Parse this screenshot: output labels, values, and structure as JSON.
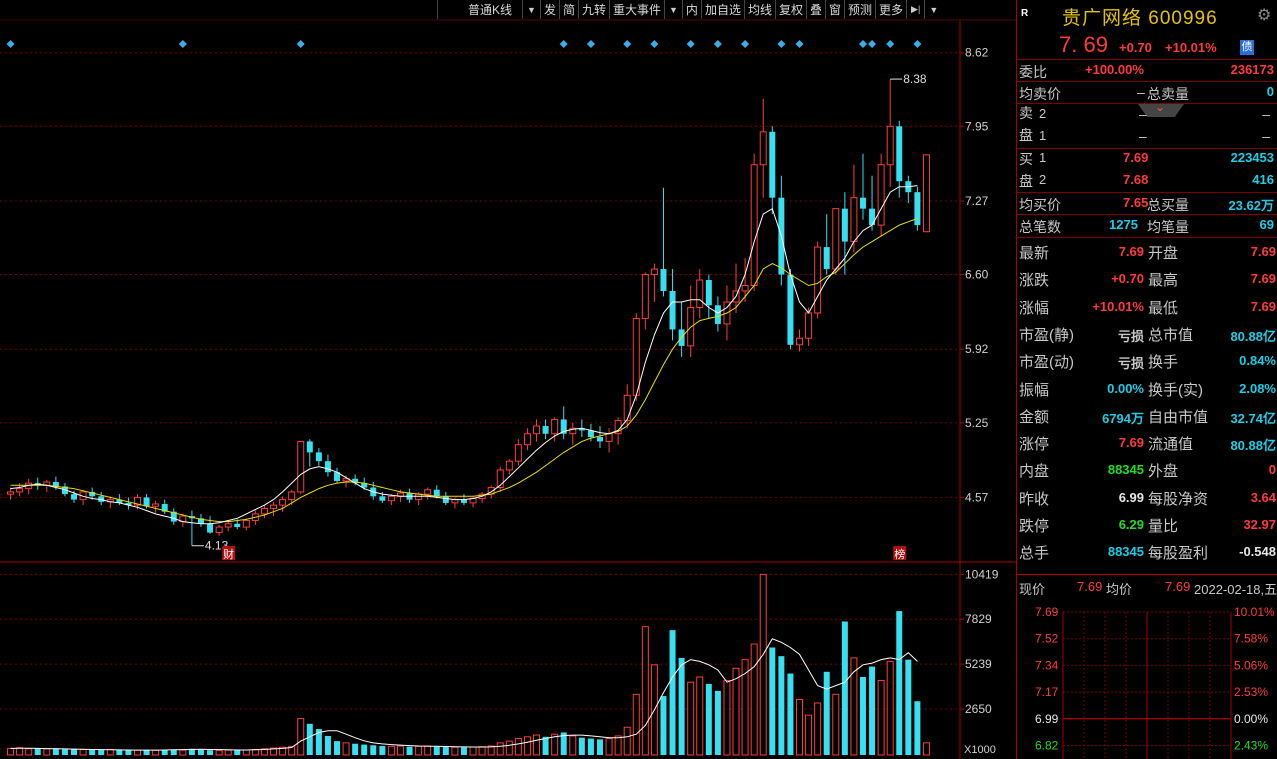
{
  "toolbar": {
    "items": [
      "普通K线",
      "发",
      "简",
      "九转",
      "重大事件",
      "内",
      "加自选",
      "均线",
      "复权",
      "叠",
      "窗",
      "预测",
      "更多"
    ]
  },
  "colors": {
    "up": "#ff3b3b",
    "down": "#36e0f0",
    "ma5": "#ffffff",
    "ma10": "#e8e000",
    "grid": "#7a0000",
    "axis": "#aa0000"
  },
  "chart_data": [
    {
      "type": "candlestick",
      "title": "",
      "y_ticks": [
        "8.62",
        "7.95",
        "7.27",
        "6.60",
        "5.92",
        "5.25",
        "4.57"
      ],
      "ylim": [
        4.0,
        8.9
      ],
      "annotations": {
        "high_label": "8.38",
        "low_label": "4.13",
        "tag_left": "财",
        "tag_right": "榜"
      },
      "candles": [
        [
          4.6,
          4.66,
          4.55,
          4.62
        ],
        [
          4.62,
          4.7,
          4.58,
          4.65
        ],
        [
          4.65,
          4.74,
          4.6,
          4.7
        ],
        [
          4.7,
          4.75,
          4.64,
          4.68
        ],
        [
          4.68,
          4.73,
          4.62,
          4.71
        ],
        [
          4.71,
          4.76,
          4.64,
          4.67
        ],
        [
          4.67,
          4.7,
          4.58,
          4.6
        ],
        [
          4.6,
          4.63,
          4.52,
          4.55
        ],
        [
          4.55,
          4.64,
          4.5,
          4.62
        ],
        [
          4.62,
          4.66,
          4.55,
          4.58
        ],
        [
          4.58,
          4.62,
          4.5,
          4.53
        ],
        [
          4.53,
          4.58,
          4.47,
          4.55
        ],
        [
          4.55,
          4.6,
          4.5,
          4.52
        ],
        [
          4.52,
          4.57,
          4.46,
          4.5
        ],
        [
          4.5,
          4.6,
          4.46,
          4.57
        ],
        [
          4.57,
          4.6,
          4.47,
          4.49
        ],
        [
          4.49,
          4.54,
          4.43,
          4.51
        ],
        [
          4.51,
          4.55,
          4.42,
          4.44
        ],
        [
          4.44,
          4.47,
          4.32,
          4.35
        ],
        [
          4.35,
          4.42,
          4.3,
          4.4
        ],
        [
          4.4,
          4.45,
          4.13,
          4.38
        ],
        [
          4.38,
          4.42,
          4.3,
          4.33
        ],
        [
          4.33,
          4.4,
          4.24,
          4.25
        ],
        [
          4.25,
          4.32,
          4.22,
          4.3
        ],
        [
          4.3,
          4.36,
          4.26,
          4.33
        ],
        [
          4.33,
          4.37,
          4.28,
          4.3
        ],
        [
          4.3,
          4.38,
          4.27,
          4.36
        ],
        [
          4.36,
          4.45,
          4.32,
          4.42
        ],
        [
          4.42,
          4.5,
          4.38,
          4.47
        ],
        [
          4.47,
          4.53,
          4.4,
          4.5
        ],
        [
          4.5,
          4.58,
          4.44,
          4.55
        ],
        [
          4.55,
          4.64,
          4.5,
          4.62
        ],
        [
          4.62,
          5.08,
          4.6,
          5.08
        ],
        [
          5.08,
          5.1,
          4.85,
          4.98
        ],
        [
          4.98,
          5.02,
          4.86,
          4.9
        ],
        [
          4.9,
          4.96,
          4.76,
          4.8
        ],
        [
          4.8,
          4.84,
          4.7,
          4.72
        ],
        [
          4.72,
          4.77,
          4.66,
          4.74
        ],
        [
          4.74,
          4.78,
          4.68,
          4.7
        ],
        [
          4.7,
          4.75,
          4.64,
          4.66
        ],
        [
          4.66,
          4.71,
          4.55,
          4.58
        ],
        [
          4.58,
          4.62,
          4.52,
          4.54
        ],
        [
          4.54,
          4.6,
          4.5,
          4.58
        ],
        [
          4.58,
          4.64,
          4.53,
          4.61
        ],
        [
          4.61,
          4.65,
          4.52,
          4.55
        ],
        [
          4.55,
          4.62,
          4.5,
          4.6
        ],
        [
          4.6,
          4.66,
          4.55,
          4.64
        ],
        [
          4.64,
          4.68,
          4.56,
          4.58
        ],
        [
          4.58,
          4.62,
          4.5,
          4.52
        ],
        [
          4.52,
          4.57,
          4.47,
          4.55
        ],
        [
          4.55,
          4.6,
          4.5,
          4.52
        ],
        [
          4.52,
          4.58,
          4.48,
          4.56
        ],
        [
          4.56,
          4.62,
          4.52,
          4.6
        ],
        [
          4.6,
          4.68,
          4.56,
          4.66
        ],
        [
          4.66,
          4.85,
          4.62,
          4.82
        ],
        [
          4.82,
          4.92,
          4.78,
          4.9
        ],
        [
          4.9,
          5.1,
          4.86,
          5.05
        ],
        [
          5.05,
          5.2,
          5.0,
          5.15
        ],
        [
          5.15,
          5.28,
          5.08,
          5.22
        ],
        [
          5.22,
          5.28,
          5.1,
          5.15
        ],
        [
          5.15,
          5.3,
          5.08,
          5.28
        ],
        [
          5.28,
          5.4,
          5.1,
          5.15
        ],
        [
          5.15,
          5.25,
          5.05,
          5.2
        ],
        [
          5.2,
          5.28,
          5.12,
          5.18
        ],
        [
          5.18,
          5.24,
          5.08,
          5.12
        ],
        [
          5.12,
          5.22,
          5.02,
          5.08
        ],
        [
          5.08,
          5.2,
          4.98,
          5.15
        ],
        [
          5.15,
          5.3,
          5.05,
          5.27
        ],
        [
          5.27,
          5.6,
          5.2,
          5.5
        ],
        [
          5.5,
          6.25,
          5.45,
          6.2
        ],
        [
          6.2,
          6.62,
          6.1,
          6.6
        ],
        [
          6.6,
          6.7,
          6.35,
          6.65
        ],
        [
          6.65,
          7.39,
          6.4,
          6.45
        ],
        [
          6.45,
          6.65,
          6.0,
          6.1
        ],
        [
          6.1,
          6.35,
          5.85,
          5.95
        ],
        [
          5.95,
          6.5,
          5.85,
          6.3
        ],
        [
          6.3,
          6.65,
          6.2,
          6.55
        ],
        [
          6.55,
          6.6,
          6.2,
          6.32
        ],
        [
          6.32,
          6.4,
          6.08,
          6.15
        ],
        [
          6.15,
          6.5,
          6.0,
          6.35
        ],
        [
          6.35,
          6.7,
          6.25,
          6.45
        ],
        [
          6.45,
          6.75,
          6.35,
          6.5
        ],
        [
          6.5,
          7.7,
          6.45,
          7.6
        ],
        [
          7.6,
          8.2,
          7.3,
          7.9
        ],
        [
          7.9,
          7.95,
          7.15,
          7.3
        ],
        [
          7.3,
          7.5,
          6.5,
          6.6
        ],
        [
          6.6,
          6.65,
          5.92,
          5.96
        ],
        [
          5.96,
          6.1,
          5.9,
          6.02
        ],
        [
          6.02,
          6.3,
          5.95,
          6.25
        ],
        [
          6.25,
          6.9,
          6.2,
          6.85
        ],
        [
          6.85,
          7.15,
          6.6,
          6.65
        ],
        [
          6.65,
          7.2,
          6.6,
          7.2
        ],
        [
          7.2,
          7.35,
          6.6,
          6.9
        ],
        [
          6.9,
          7.6,
          6.8,
          7.3
        ],
        [
          7.3,
          7.7,
          7.1,
          7.2
        ],
        [
          7.2,
          7.5,
          7.0,
          7.05
        ],
        [
          7.05,
          7.7,
          6.95,
          7.6
        ],
        [
          7.6,
          8.38,
          7.4,
          7.95
        ],
        [
          7.95,
          8.0,
          7.3,
          7.45
        ],
        [
          7.45,
          7.5,
          7.25,
          7.35
        ],
        [
          7.35,
          7.4,
          7.0,
          7.05
        ],
        [
          6.99,
          7.69,
          6.99,
          7.69
        ]
      ],
      "ma5": [
        4.65,
        4.66,
        4.68,
        4.69,
        4.68,
        4.66,
        4.64,
        4.61,
        4.58,
        4.56,
        4.55,
        4.53,
        4.52,
        4.5,
        4.48,
        4.45,
        4.42,
        4.4,
        4.38,
        4.35,
        4.34,
        4.33,
        4.33,
        4.34,
        4.36,
        4.38,
        4.42,
        4.46,
        4.5,
        4.55,
        4.62,
        4.7,
        4.78,
        4.83,
        4.85,
        4.83,
        4.8,
        4.75,
        4.7,
        4.65,
        4.62,
        4.6,
        4.59,
        4.58,
        4.58,
        4.58,
        4.58,
        4.57,
        4.56,
        4.55,
        4.55,
        4.56,
        4.58,
        4.62,
        4.68,
        4.76,
        4.84,
        4.92,
        5.0,
        5.07,
        5.13,
        5.17,
        5.19,
        5.2,
        5.18,
        5.16,
        5.15,
        5.18,
        5.28,
        5.5,
        5.8,
        6.05,
        6.25,
        6.35,
        6.35,
        6.37,
        6.37,
        6.3,
        6.25,
        6.3,
        6.4,
        6.6,
        6.9,
        7.15,
        7.2,
        6.95,
        6.6,
        6.35,
        6.25,
        6.4,
        6.55,
        6.65,
        6.75,
        6.9,
        7.0,
        7.05,
        7.2,
        7.35,
        7.4,
        7.4,
        7.41
      ],
      "ma10": [
        4.68,
        4.68,
        4.68,
        4.68,
        4.68,
        4.67,
        4.66,
        4.65,
        4.63,
        4.61,
        4.59,
        4.57,
        4.55,
        4.53,
        4.51,
        4.49,
        4.47,
        4.45,
        4.43,
        4.41,
        4.39,
        4.37,
        4.36,
        4.35,
        4.35,
        4.36,
        4.37,
        4.39,
        4.41,
        4.44,
        4.47,
        4.52,
        4.57,
        4.61,
        4.65,
        4.68,
        4.7,
        4.71,
        4.71,
        4.7,
        4.68,
        4.66,
        4.64,
        4.62,
        4.61,
        4.6,
        4.59,
        4.58,
        4.58,
        4.58,
        4.58,
        4.58,
        4.59,
        4.6,
        4.63,
        4.66,
        4.7,
        4.75,
        4.8,
        4.86,
        4.92,
        4.98,
        5.03,
        5.08,
        5.11,
        5.13,
        5.15,
        5.17,
        5.22,
        5.32,
        5.46,
        5.62,
        5.78,
        5.92,
        6.03,
        6.12,
        6.18,
        6.2,
        6.22,
        6.25,
        6.3,
        6.4,
        6.5,
        6.65,
        6.7,
        6.66,
        6.6,
        6.55,
        6.5,
        6.52,
        6.58,
        6.62,
        6.7,
        6.78,
        6.85,
        6.9,
        6.95,
        7.0,
        7.05,
        7.08,
        7.11
      ]
    },
    {
      "type": "bar",
      "title": "",
      "y_ticks": [
        "10419",
        "7829",
        "5239",
        "2650"
      ],
      "unit_label": "X1000",
      "ylim": [
        0,
        10900
      ],
      "volumes": [
        380,
        420,
        360,
        400,
        350,
        390,
        330,
        360,
        310,
        340,
        300,
        320,
        290,
        310,
        280,
        300,
        270,
        290,
        320,
        280,
        360,
        300,
        280,
        260,
        280,
        270,
        290,
        320,
        360,
        400,
        450,
        500,
        2100,
        1800,
        1500,
        1100,
        800,
        700,
        650,
        600,
        560,
        520,
        500,
        520,
        480,
        500,
        520,
        480,
        460,
        450,
        440,
        460,
        480,
        520,
        700,
        800,
        950,
        1050,
        1150,
        1050,
        1200,
        1300,
        1100,
        1000,
        950,
        900,
        950,
        1100,
        1600,
        3500,
        7400,
        5200,
        3400,
        7200,
        5600,
        4200,
        4500,
        4100,
        3700,
        4300,
        5000,
        5500,
        6400,
        10419,
        6200,
        5700,
        4700,
        3200,
        2300,
        3000,
        4800,
        3500,
        7700,
        5600,
        4500,
        5100,
        4300,
        5400,
        8300,
        5500,
        3100,
        700
      ],
      "vma5": [
        380,
        390,
        390,
        380,
        370,
        360,
        350,
        340,
        330,
        320,
        310,
        300,
        295,
        290,
        285,
        280,
        285,
        290,
        300,
        310,
        320,
        330,
        320,
        310,
        300,
        290,
        290,
        300,
        320,
        350,
        380,
        430,
        800,
        1050,
        1300,
        1400,
        1400,
        1200,
        1000,
        820,
        700,
        640,
        600,
        570,
        540,
        520,
        510,
        500,
        490,
        480,
        470,
        460,
        460,
        470,
        500,
        560,
        640,
        740,
        850,
        950,
        1050,
        1120,
        1150,
        1150,
        1100,
        1050,
        1000,
        1000,
        1050,
        1200,
        1700,
        2600,
        3600,
        4500,
        5200,
        5500,
        5400,
        5200,
        4900,
        4200,
        4400,
        4700,
        5100,
        5800,
        6700,
        6500,
        6200,
        5800,
        4900,
        4000,
        3800,
        4000,
        4200,
        4800,
        5200,
        5300,
        5500,
        5600,
        5500,
        5900,
        5400
      ]
    },
    {
      "type": "line",
      "title": "",
      "left_ticks": [
        "7.69",
        "7.52",
        "7.34",
        "7.17",
        "6.99",
        "6.82"
      ],
      "right_ticks": [
        "10.01%",
        "7.58%",
        "5.06%",
        "2.53%",
        "0.00%",
        "2.43%"
      ]
    }
  ],
  "panel": {
    "badge": "R",
    "stock_name": "贵广网络 600996",
    "price": "7. 69",
    "change": "+0.70",
    "change_pct": "+10.01%",
    "bond_badge": "债",
    "wei_bi_label": "委比",
    "wei_bi": "+100.00%",
    "wei_cha": "236173",
    "avg_sell_label": "均卖价",
    "avg_sell": "–",
    "total_sell_label": "总卖量",
    "total_sell": "0",
    "sell_side_label": "卖盘",
    "buy_side_label": "买盘",
    "sells": [
      {
        "level": "2",
        "price": "–",
        "vol": "–"
      },
      {
        "level": "1",
        "price": "–",
        "vol": "–"
      }
    ],
    "buys": [
      {
        "level": "1",
        "price": "7.69",
        "vol": "223453"
      },
      {
        "level": "2",
        "price": "7.68",
        "vol": "416"
      }
    ],
    "avg_buy_label": "均买价",
    "avg_buy": "7.65",
    "total_buy_label": "总买量",
    "total_buy": "23.62万",
    "total_trades_label": "总笔数",
    "total_trades": "1275",
    "avg_lot_label": "均笔量",
    "avg_lot": "69",
    "stats": [
      {
        "l1": "最新",
        "v1": "7.69",
        "c1": "red",
        "l2": "开盘",
        "v2": "7.69",
        "c2": "red"
      },
      {
        "l1": "涨跌",
        "v1": "+0.70",
        "c1": "red",
        "l2": "最高",
        "v2": "7.69",
        "c2": "red"
      },
      {
        "l1": "涨幅",
        "v1": "+10.01%",
        "c1": "red",
        "l2": "最低",
        "v2": "7.69",
        "c2": "red"
      },
      {
        "l1": "市盈(静)",
        "v1": "亏损",
        "c1": "gray",
        "l2": "总市值",
        "v2": "80.88亿",
        "c2": "cyan"
      },
      {
        "l1": "市盈(动)",
        "v1": "亏损",
        "c1": "gray",
        "l2": "换手",
        "v2": "0.84%",
        "c2": "cyan"
      },
      {
        "l1": "振幅",
        "v1": "0.00%",
        "c1": "cyan",
        "l2": "换手(实)",
        "v2": "2.08%",
        "c2": "cyan"
      },
      {
        "l1": "金额",
        "v1": "6794万",
        "c1": "cyan",
        "l2": "自由市值",
        "v2": "32.74亿",
        "c2": "cyan"
      },
      {
        "l1": "涨停",
        "v1": "7.69",
        "c1": "red",
        "l2": "流通值",
        "v2": "80.88亿",
        "c2": "cyan"
      },
      {
        "l1": "内盘",
        "v1": "88345",
        "c1": "green",
        "l2": "外盘",
        "v2": "0",
        "c2": "red"
      },
      {
        "l1": "昨收",
        "v1": "6.99",
        "c1": "white",
        "l2": "每股净资",
        "v2": "3.64",
        "c2": "red"
      },
      {
        "l1": "跌停",
        "v1": "6.29",
        "c1": "green",
        "l2": "量比",
        "v2": "32.97",
        "c2": "red"
      },
      {
        "l1": "总手",
        "v1": "88345",
        "c1": "cyan",
        "l2": "每股盈利",
        "v2": "-0.548",
        "c2": "white"
      }
    ],
    "mini_header": {
      "now_label": "现价",
      "now": "7.69",
      "avg_label": "均价",
      "avg": "7.69",
      "date": "2022-02-18,五"
    }
  }
}
